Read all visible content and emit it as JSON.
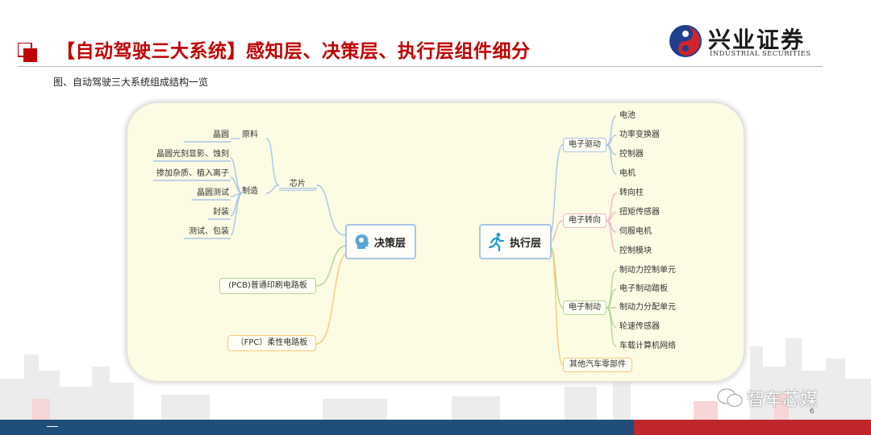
{
  "header": {
    "title": "【自动驾驶三大系统】感知层、决策层、执行层组件细分",
    "caption": "图、自动驾驶三大系统组成结构一览",
    "logo_cn": "兴业证券",
    "logo_en": "INDUSTRIAL SECURITIES"
  },
  "mindmap": {
    "decision": {
      "label": "决策层",
      "chip": {
        "label": "芯片",
        "material": {
          "label": "原料",
          "children": [
            "晶圆"
          ]
        },
        "manufacturing": {
          "label": "制造",
          "children": [
            "晶圆光刻显影、蚀刻",
            "掺加杂质、植入离子",
            "晶圆测试",
            "封装",
            "测试、包装"
          ]
        }
      },
      "pcb": "(PCB)普通印刷电路板",
      "fpc": "（FPC）柔性电路板"
    },
    "execution": {
      "label": "执行层",
      "drive": {
        "label": "电子驱动",
        "children": [
          "电池",
          "功率变换器",
          "控制器",
          "电机"
        ]
      },
      "steering": {
        "label": "电子转向",
        "children": [
          "转向柱",
          "扭矩传感器",
          "伺服电机",
          "控制模块"
        ]
      },
      "braking": {
        "label": "电子制动",
        "children": [
          "制动力控制单元",
          "电子制动踏板",
          "制动力分配单元",
          "轮速传感器",
          "车载计算机网络"
        ]
      },
      "other": "其他汽车零部件"
    }
  },
  "footer": {
    "page_number": "6",
    "watermark": "智车芯媒"
  },
  "colors": {
    "title_red": "#c00000",
    "footer_blue": "#1f4e79",
    "footer_red": "#c0272d",
    "branch_blue": "#a9c6e8",
    "branch_green": "#b5d69a",
    "branch_orange": "#f6c97a",
    "branch_pink": "#f2b6c9"
  }
}
